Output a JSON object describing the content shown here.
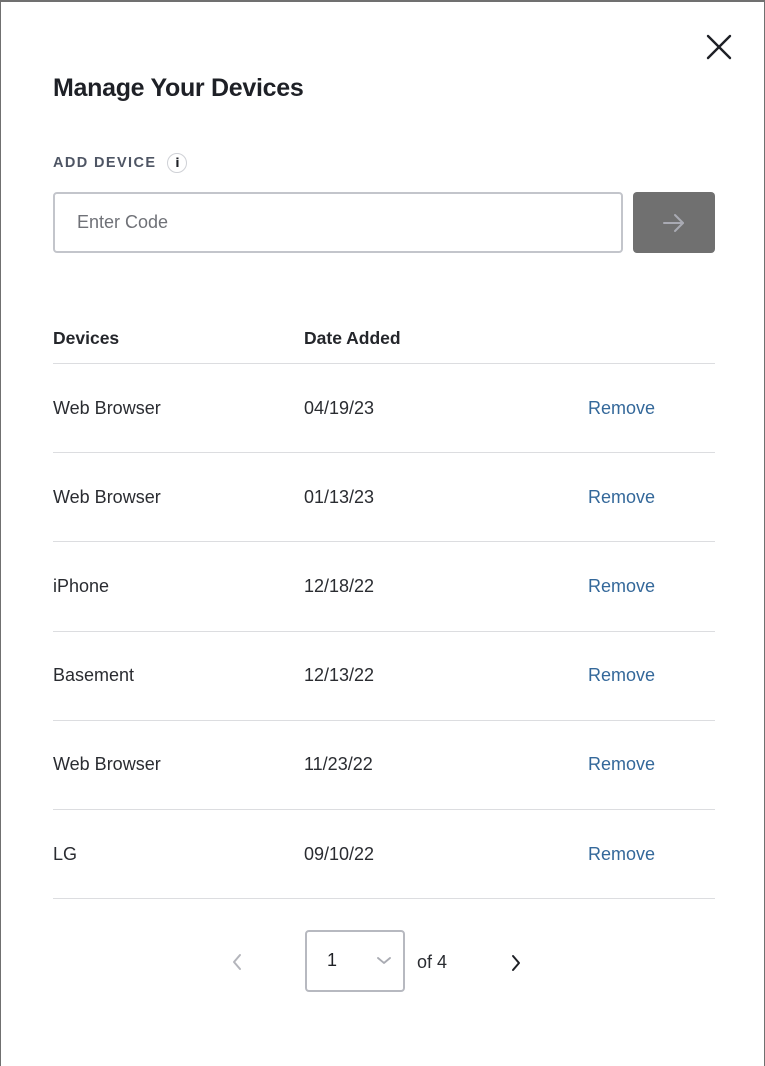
{
  "modal": {
    "title": "Manage Your Devices",
    "close_icon": "close-icon"
  },
  "add_device": {
    "label": "ADD DEVICE",
    "info_icon": "i",
    "input_placeholder": "Enter Code",
    "input_value": "",
    "submit_icon": "arrow-right-icon"
  },
  "table": {
    "headers": {
      "device": "Devices",
      "date": "Date Added"
    },
    "rows": [
      {
        "device": "Web Browser",
        "date": "04/19/23",
        "action": "Remove"
      },
      {
        "device": "Web Browser",
        "date": "01/13/23",
        "action": "Remove"
      },
      {
        "device": "iPhone",
        "date": "12/18/22",
        "action": "Remove"
      },
      {
        "device": "Basement",
        "date": "12/13/22",
        "action": "Remove"
      },
      {
        "device": "Web Browser",
        "date": "11/23/22",
        "action": "Remove"
      },
      {
        "device": "LG",
        "date": "09/10/22",
        "action": "Remove"
      }
    ]
  },
  "pagination": {
    "current_page": "1",
    "of_label": "of 4",
    "total_pages": 4
  },
  "colors": {
    "link": "#34689a",
    "submit_button": "#707070",
    "heading": "#1e2026",
    "label": "#4e5564",
    "divider": "#dcdde0"
  }
}
